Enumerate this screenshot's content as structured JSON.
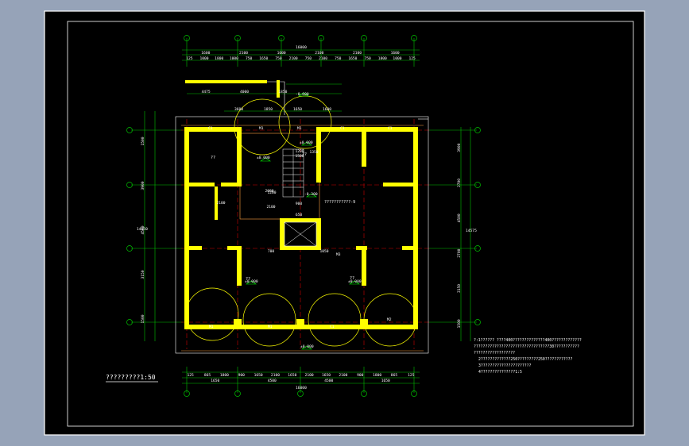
{
  "drawing": {
    "scale_label": "?????????1:50",
    "top_dims_row1": [
      "1600",
      "2100",
      "1600",
      "2100",
      "2100",
      "1600"
    ],
    "top_dims_row2": [
      "1600",
      "2100",
      "1600",
      "2100",
      "2100",
      "1600"
    ],
    "top_dims_row3": [
      "125",
      "1000",
      "1800",
      "1000",
      "750",
      "1650",
      "750",
      "2100",
      "750",
      "2100",
      "750",
      "1650",
      "750",
      "1800",
      "1000",
      "125"
    ],
    "top_total": "16000",
    "bottom_dims_row1": [
      "125",
      "865",
      "1800",
      "900",
      "1650",
      "2100",
      "1650",
      "2100",
      "1650",
      "2100",
      "900",
      "1800",
      "865",
      "125"
    ],
    "bottom_dims_row2": [
      "1650",
      "4500",
      "4500",
      "1650"
    ],
    "bottom_total": "16000",
    "left_dims": [
      "1500",
      "3900",
      "4500",
      "3150",
      "1500"
    ],
    "left_total": "14650",
    "right_dims": [
      "3900",
      "2700",
      "4500",
      "2700",
      "3150",
      "1500"
    ],
    "right_total": "14575",
    "upper_dims": [
      "4475",
      "4000",
      "1850",
      "3600",
      "1850",
      "1650",
      "1600"
    ],
    "room_labels": [
      "??",
      "??",
      "??",
      "??"
    ],
    "door_labels": [
      "C1",
      "M1",
      "M1",
      "C1",
      "C1",
      "M1",
      "M1",
      "C1",
      "M2",
      "M3"
    ],
    "level_labels": [
      "±0.000",
      "±0.000",
      "-0.300",
      "-0.600",
      "±0.000",
      "±0.000",
      "±0.000"
    ],
    "callout": "???????????-9",
    "small_dims": [
      "1200",
      "1500",
      "2000",
      "2100",
      "2100",
      "900",
      "650",
      "1050",
      "1350",
      "1200",
      "700"
    ],
    "notes": [
      "?:1?????? ????400??????????????400?????????????",
      "      ?????????????????????????????????30???????????",
      "      ??????????????????",
      "2?????????????250?????????250????????????",
      "3??????????????????????",
      "4???????????????1:5"
    ]
  }
}
